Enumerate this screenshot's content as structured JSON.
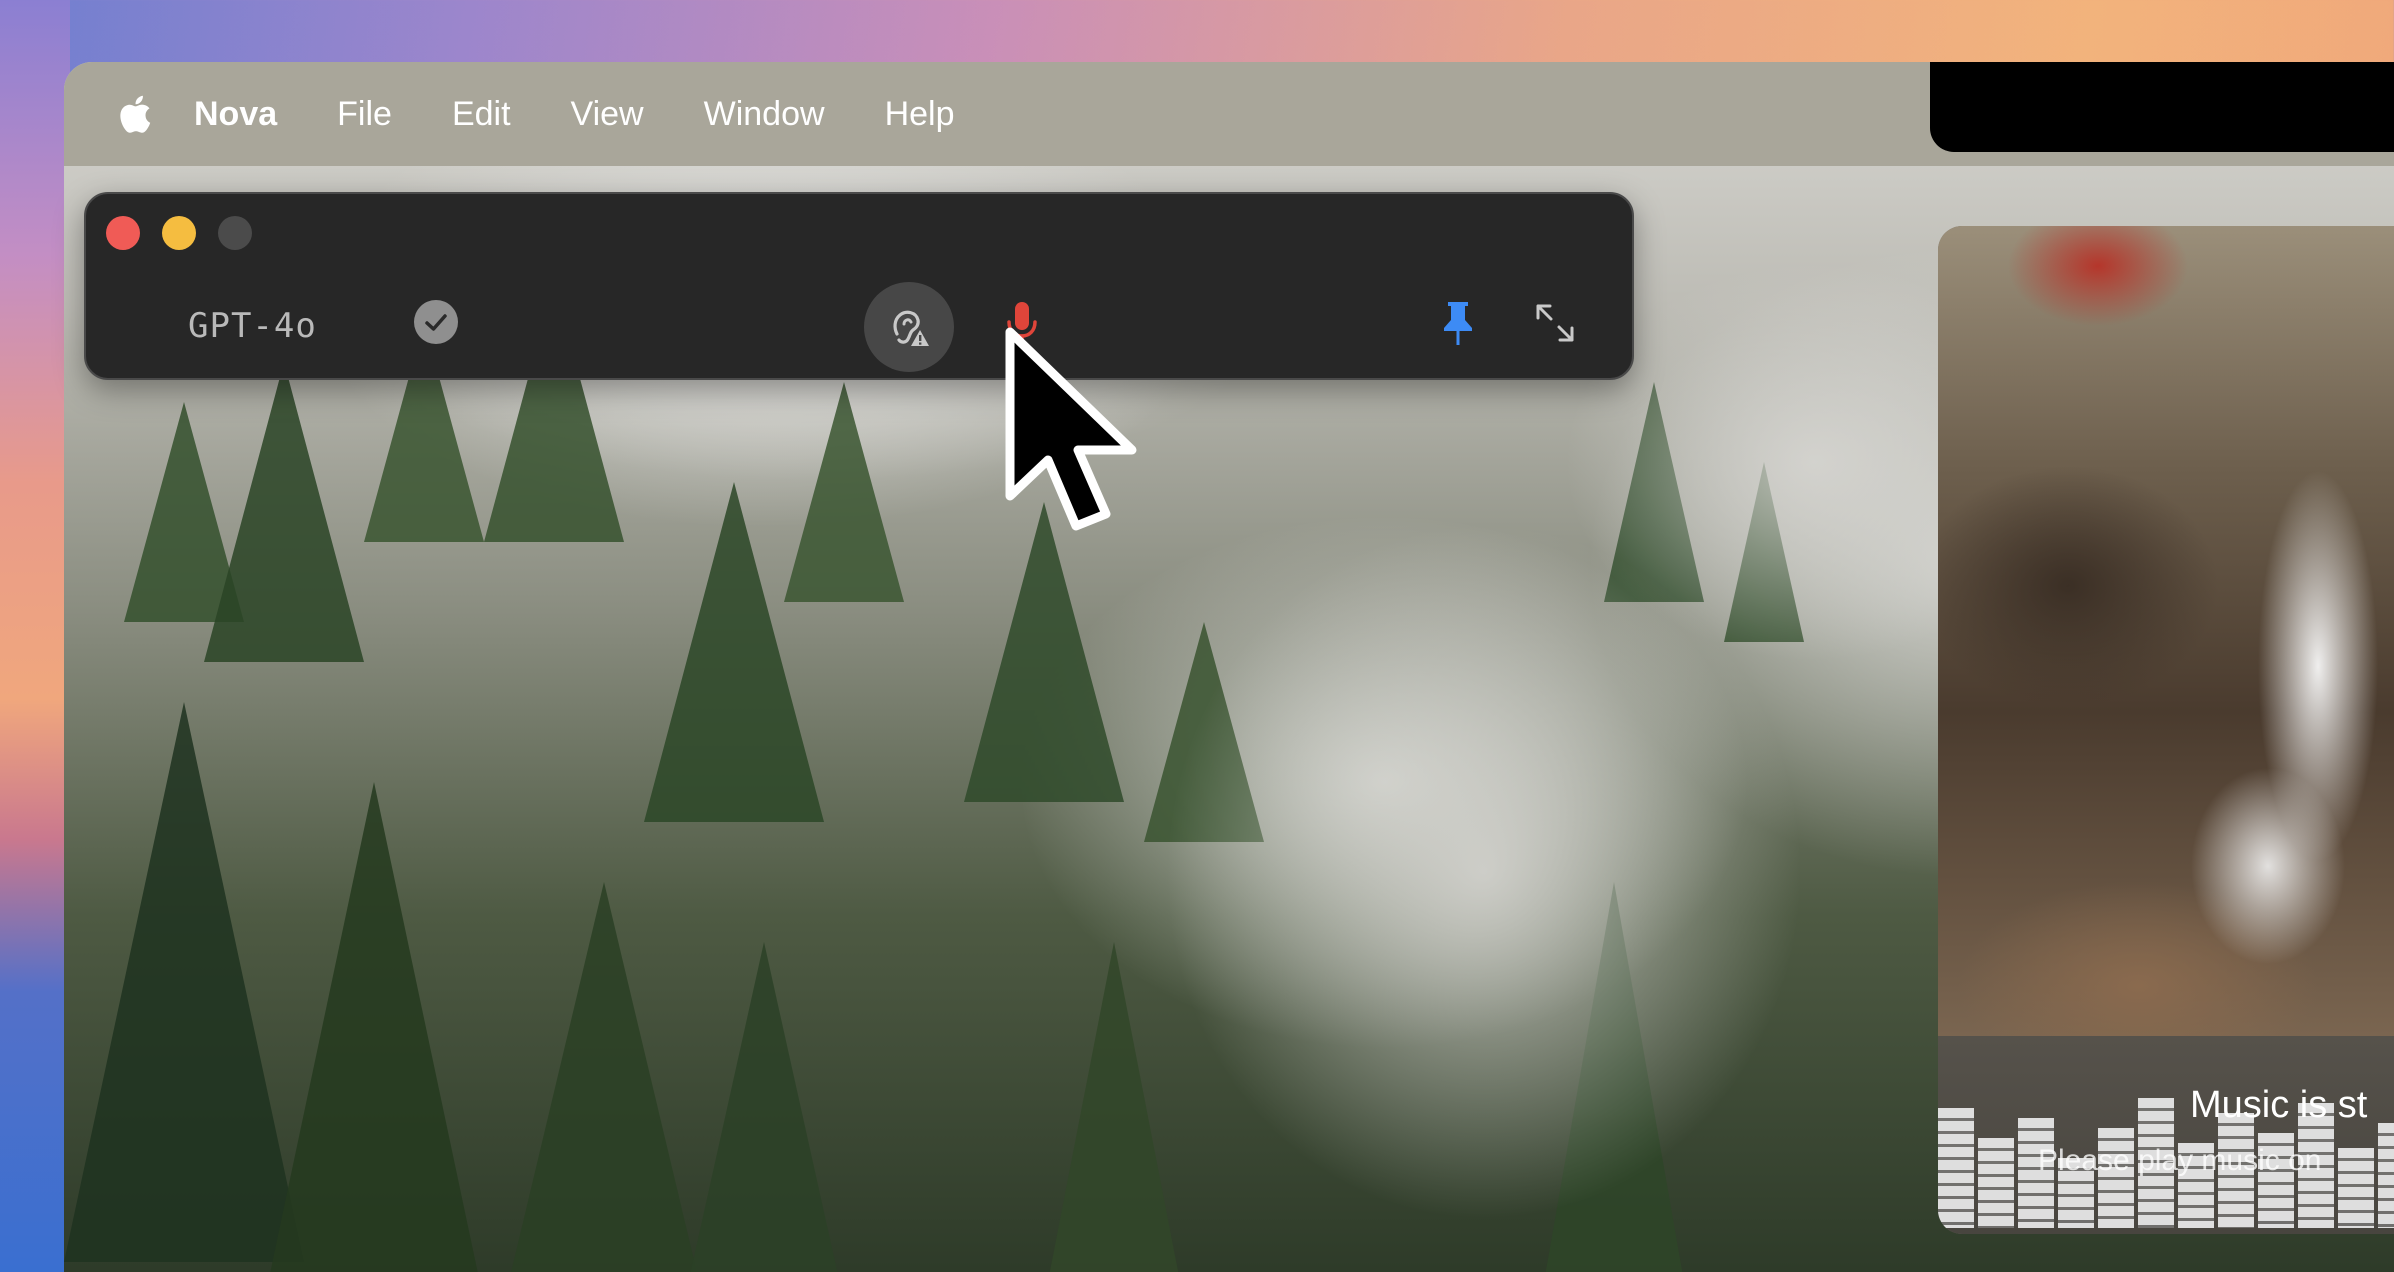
{
  "menubar": {
    "apple_icon": "apple-logo-icon",
    "app_name": "Nova",
    "items": [
      "File",
      "Edit",
      "View",
      "Window",
      "Help"
    ]
  },
  "nova_window": {
    "model": "GPT-4o",
    "icons": {
      "status": "checkmark-circle-icon",
      "hearing": "hearing-warning-icon",
      "microphone": "microphone-icon",
      "pin": "pin-icon",
      "expand": "expand-arrows-icon"
    },
    "colors": {
      "close": "#f05b56",
      "minimize": "#f5bd40",
      "zoom_disabled": "#4b4b4b",
      "mic_active": "#e0453a",
      "pin_active": "#3d8bf5"
    }
  },
  "music_widget": {
    "title": "Music is st",
    "subtitle": "Please play music on"
  }
}
